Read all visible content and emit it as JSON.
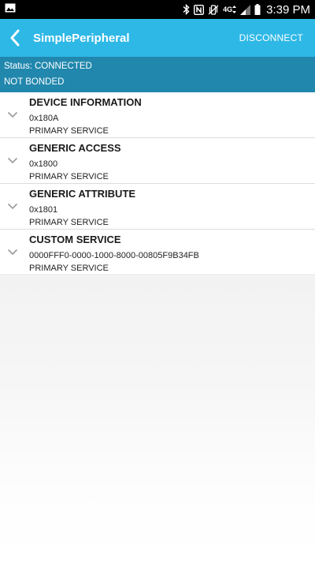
{
  "status_bar": {
    "time": "3:39 PM",
    "network_label": "4G",
    "icons": [
      "image-icon",
      "bluetooth-icon",
      "nfc-icon",
      "vibrate-icon",
      "network-4g-icon",
      "signal-icon",
      "battery-icon"
    ]
  },
  "app_bar": {
    "title": "SimplePeripheral",
    "disconnect_label": "DISCONNECT",
    "back_icon": "chevron-left-icon"
  },
  "status_panel": {
    "status_text": "Status: CONNECTED",
    "bond_text": "NOT BONDED"
  },
  "services": [
    {
      "name": "DEVICE INFORMATION",
      "uuid": "0x180A",
      "type": "PRIMARY SERVICE"
    },
    {
      "name": "GENERIC ACCESS",
      "uuid": "0x1800",
      "type": "PRIMARY SERVICE"
    },
    {
      "name": "GENERIC ATTRIBUTE",
      "uuid": "0x1801",
      "type": "PRIMARY SERVICE"
    },
    {
      "name": "CUSTOM SERVICE",
      "uuid": "0000FFF0-0000-1000-8000-00805F9B34FB",
      "type": "PRIMARY SERVICE"
    }
  ],
  "colors": {
    "app_bar": "#2eb8e6",
    "status_panel": "#2187ad",
    "status_bar": "#000000"
  }
}
